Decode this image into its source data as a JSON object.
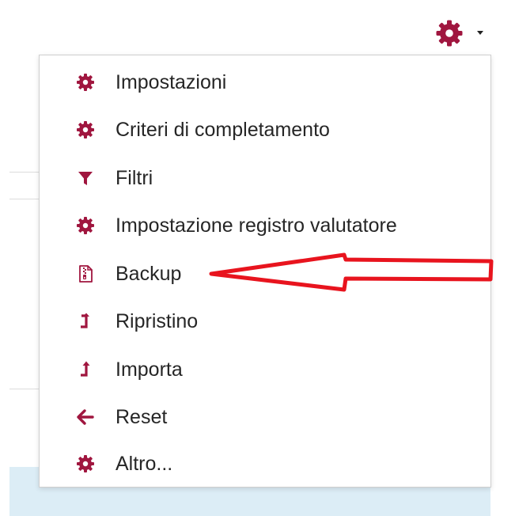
{
  "accent_color": "#a0163f",
  "annotation_color": "#e8141e",
  "settings_toggle": {
    "icon": "gear-icon",
    "caret_icon": "caret-down-icon"
  },
  "menu": {
    "items": [
      {
        "label": "Impostazioni",
        "icon": "gear-icon"
      },
      {
        "label": "Criteri di completamento",
        "icon": "gear-icon"
      },
      {
        "label": "Filtri",
        "icon": "filter-icon"
      },
      {
        "label": "Impostazione registro valutatore",
        "icon": "gear-icon"
      },
      {
        "label": "Backup",
        "icon": "file-archive-icon"
      },
      {
        "label": "Ripristino",
        "icon": "level-up-icon"
      },
      {
        "label": "Importa",
        "icon": "level-up-icon"
      },
      {
        "label": "Reset",
        "icon": "arrow-left-icon"
      },
      {
        "label": "Altro...",
        "icon": "gear-icon"
      }
    ]
  }
}
